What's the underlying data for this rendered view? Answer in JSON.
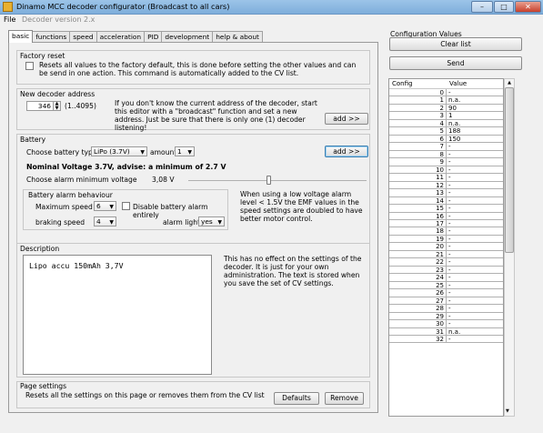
{
  "window": {
    "title": "Dinamo MCC decoder configurator (Broadcast to all cars)",
    "minimize": "–",
    "maximize": "□",
    "close": "✕"
  },
  "menu": {
    "file": "File",
    "version": "Decoder version 2.x"
  },
  "tabs": [
    {
      "label": "basic",
      "active": true
    },
    {
      "label": "functions"
    },
    {
      "label": "speed"
    },
    {
      "label": "acceleration"
    },
    {
      "label": "PID"
    },
    {
      "label": "development"
    },
    {
      "label": "help & about"
    }
  ],
  "factory_reset": {
    "title": "Factory reset",
    "text": "Resets all values to the factory default, this is done before setting the other values and can be send in one action. This command is automatically added to the CV list."
  },
  "new_address": {
    "title": "New decoder address",
    "value": "346",
    "range": "(1..4095)",
    "help": "If you don't know the current address of the decoder, start this editor with a \"broadcast\" function and set a new address. Just be sure that there is only one (1) decoder listening!",
    "add_button": "add >>"
  },
  "battery": {
    "title": "Battery",
    "choose_type_label": "Choose battery type",
    "type_value": "LiPo (3.7V)",
    "amount_label": "amount",
    "amount_value": "1",
    "add_button": "add >>",
    "nominal": "Nominal Voltage 3.7V, advise: a minimum of 2.7 V",
    "min_voltage_label": "Choose alarm minimum voltage",
    "min_voltage_value": "3,08 V",
    "min_voltage_fraction": 0.45,
    "alarm_title": "Battery alarm behaviour",
    "max_speed_label": "Maximum speed",
    "max_speed_value": "6",
    "disable_label": "Disable battery alarm entirely",
    "braking_label": "braking speed",
    "braking_value": "4",
    "lights_label": "alarm lights",
    "lights_value": "yes",
    "alarm_help": "When using a low voltage alarm level < 1.5V the EMF values in the speed settings are doubled to have better motor control."
  },
  "description": {
    "title": "Description",
    "value": "Lipo accu 150mAh 3,7V",
    "help": "This has no effect on the settings of the decoder. It is just for your own administration. The text is stored when you save the set of CV settings."
  },
  "page_settings": {
    "title": "Page settings",
    "text": "Resets all the settings on this page or removes them from the CV list",
    "defaults_button": "Defaults",
    "remove_button": "Remove"
  },
  "config": {
    "title": "Configuration Values",
    "clear_button": "Clear list",
    "send_button": "Send",
    "col_config": "Config",
    "col_value": "Value",
    "rows": [
      {
        "idx": "0",
        "val": "-"
      },
      {
        "idx": "1",
        "val": "n.a."
      },
      {
        "idx": "2",
        "val": "90"
      },
      {
        "idx": "3",
        "val": "1"
      },
      {
        "idx": "4",
        "val": "n.a."
      },
      {
        "idx": "5",
        "val": "188"
      },
      {
        "idx": "6",
        "val": "150"
      },
      {
        "idx": "7",
        "val": "-"
      },
      {
        "idx": "8",
        "val": "-"
      },
      {
        "idx": "9",
        "val": "-"
      },
      {
        "idx": "10",
        "val": "-"
      },
      {
        "idx": "11",
        "val": "-"
      },
      {
        "idx": "12",
        "val": "-"
      },
      {
        "idx": "13",
        "val": "-"
      },
      {
        "idx": "14",
        "val": "-"
      },
      {
        "idx": "15",
        "val": "-"
      },
      {
        "idx": "16",
        "val": "-"
      },
      {
        "idx": "17",
        "val": "-"
      },
      {
        "idx": "18",
        "val": "-"
      },
      {
        "idx": "19",
        "val": "-"
      },
      {
        "idx": "20",
        "val": "-"
      },
      {
        "idx": "21",
        "val": "-"
      },
      {
        "idx": "22",
        "val": "-"
      },
      {
        "idx": "23",
        "val": "-"
      },
      {
        "idx": "24",
        "val": "-"
      },
      {
        "idx": "25",
        "val": "-"
      },
      {
        "idx": "26",
        "val": "-"
      },
      {
        "idx": "27",
        "val": "-"
      },
      {
        "idx": "28",
        "val": "-"
      },
      {
        "idx": "29",
        "val": "-"
      },
      {
        "idx": "30",
        "val": "-"
      },
      {
        "idx": "31",
        "val": "n.a."
      },
      {
        "idx": "32",
        "val": "-"
      }
    ]
  }
}
